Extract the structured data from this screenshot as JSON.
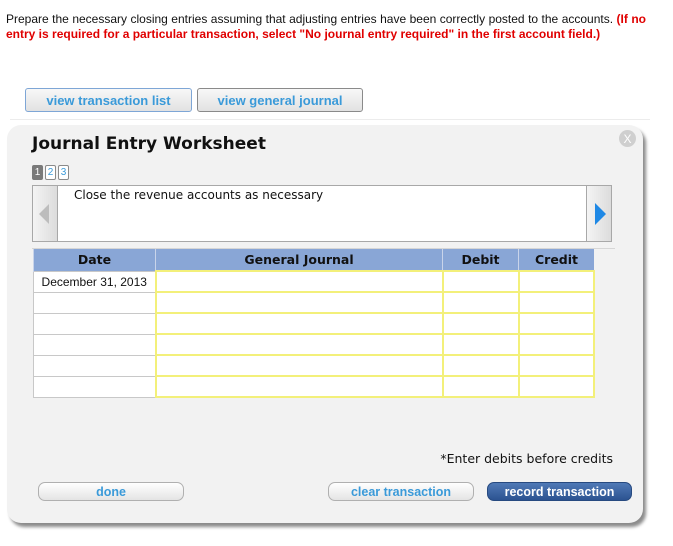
{
  "instructions": {
    "text": "Prepare the necessary closing entries assuming that adjusting entries have been correctly posted to the accounts. ",
    "emphasis": "(If no entry is required for a particular transaction, select \"No journal entry required\" in the first account field.)"
  },
  "top_buttons": {
    "view_transaction_list": "view transaction list",
    "view_general_journal": "view general journal"
  },
  "worksheet": {
    "title": "Journal Entry Worksheet",
    "close_label": "X",
    "pages": [
      "1",
      "2",
      "3"
    ],
    "current_page": "1",
    "description": "Close the revenue accounts as necessary",
    "columns": [
      "Date",
      "General Journal",
      "Debit",
      "Credit"
    ],
    "rows": [
      {
        "date": "December 31, 2013",
        "account": "",
        "debit": "",
        "credit": ""
      },
      {
        "date": "",
        "account": "",
        "debit": "",
        "credit": ""
      },
      {
        "date": "",
        "account": "",
        "debit": "",
        "credit": ""
      },
      {
        "date": "",
        "account": "",
        "debit": "",
        "credit": ""
      },
      {
        "date": "",
        "account": "",
        "debit": "",
        "credit": ""
      },
      {
        "date": "",
        "account": "",
        "debit": "",
        "credit": ""
      }
    ],
    "note": "*Enter debits before credits",
    "buttons": {
      "done": "done",
      "clear": "clear transaction",
      "record": "record transaction"
    }
  },
  "colors": {
    "header_bg": "#89a6d6",
    "input_border": "#f3f07a",
    "link_blue": "#3a9ad9",
    "emphasis_red": "#e00000",
    "primary_button": "#2c5391"
  }
}
